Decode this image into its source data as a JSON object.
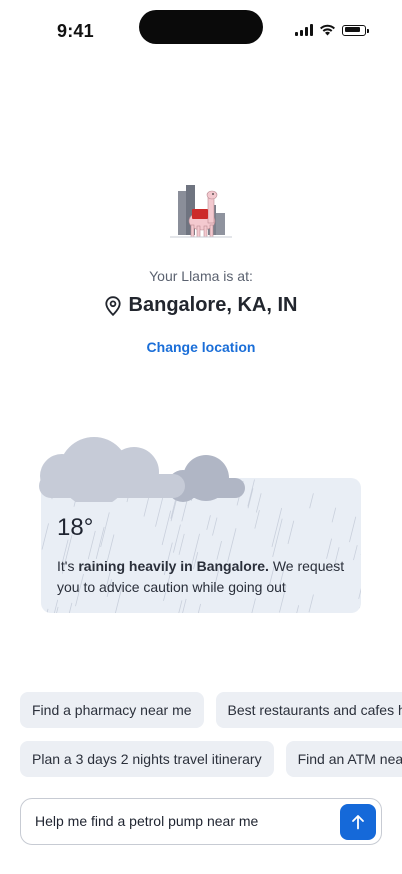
{
  "status_bar": {
    "time": "9:41",
    "icons": [
      "signal-icon",
      "wifi-icon",
      "battery-icon"
    ],
    "battery_level": 0.85
  },
  "location_panel": {
    "illustration": "llama-city-rain-illustration",
    "caption": "Your Llama is at:",
    "location_icon": "map-pin-icon",
    "location": "Bangalore, KA, IN",
    "change_label": "Change location"
  },
  "weather": {
    "icon": "cloud-rain-icon",
    "temperature": "18°",
    "message_prefix": "It's ",
    "message_bold": "raining heavily in Bangalore.",
    "message_suffix": " We request you to advice caution while going out"
  },
  "suggestions": {
    "row1": [
      "Find a pharmacy near me",
      "Best restaurants and cafes h"
    ],
    "row2": [
      "Plan a 3 days 2 nights travel itinerary",
      "Find an ATM near"
    ]
  },
  "composer": {
    "value": "Help me find a petrol pump near me",
    "send_icon": "arrow-up-icon"
  },
  "colors": {
    "accent": "#1569d9",
    "card_bg": "#e9eef5",
    "chip_bg": "#eceff4",
    "cloud_light": "#c6cbd7",
    "cloud_dark": "#b0b6c5"
  }
}
